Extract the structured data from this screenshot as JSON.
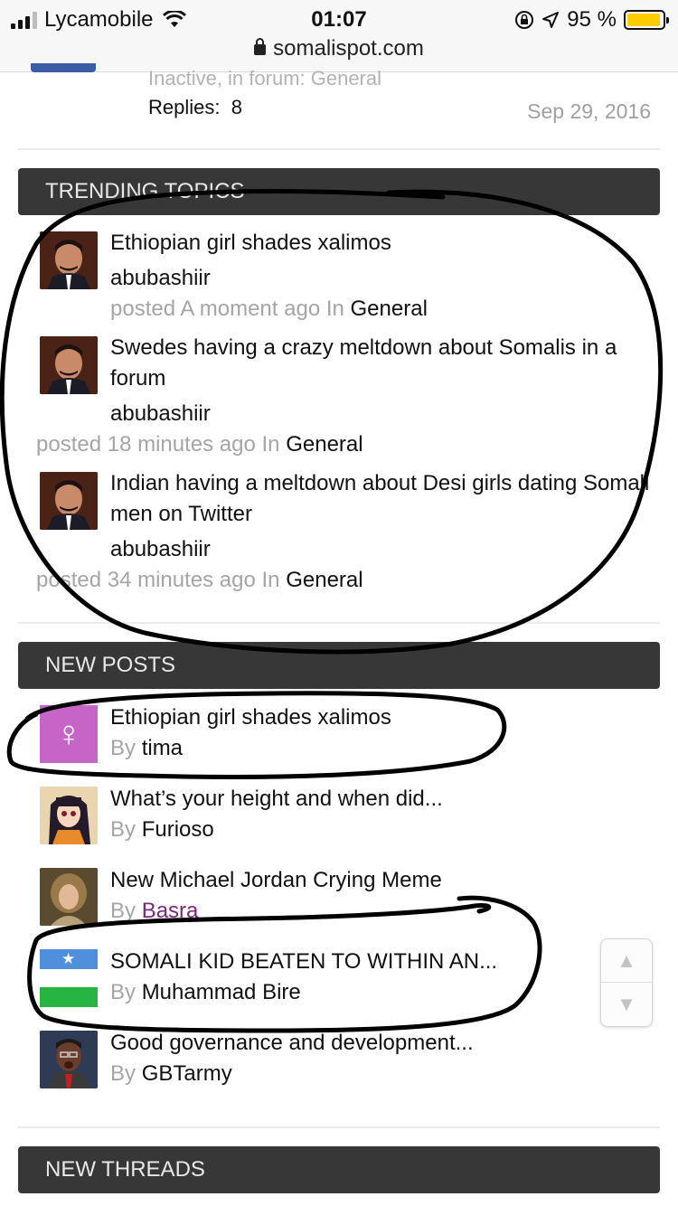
{
  "status": {
    "carrier": "Lycamobile",
    "time": "01:07",
    "battery": "95 %",
    "battery_level": 0.95,
    "url": "somalispot.com"
  },
  "previous_item": {
    "meta": "Inactive, in forum: General",
    "replies_label": "Replies:",
    "replies_count": "8",
    "date": "Sep 29, 2016"
  },
  "trending": {
    "header": "TRENDING TOPICS",
    "items": [
      {
        "title": "Ethiopian girl shades xalimos",
        "author": "abubashiir",
        "posted": "posted A moment ago In",
        "forum": "General"
      },
      {
        "title": "Swedes having a crazy meltdown about Somalis in a forum",
        "author": "abubashiir",
        "posted": "posted 18 minutes ago In",
        "forum": "General"
      },
      {
        "title": "Indian having a meltdown about Desi girls dating Somali men on Twitter",
        "author": "abubashiir",
        "posted": "posted 34 minutes ago In",
        "forum": "General"
      }
    ]
  },
  "new_posts": {
    "header": "NEW POSTS",
    "by_label": "By",
    "items": [
      {
        "title": "Ethiopian girl shades xalimos",
        "user": "tima",
        "avatar": "venus-icon"
      },
      {
        "title": "What’s your height and when did...",
        "user": "Furioso",
        "avatar": "anime-avatar"
      },
      {
        "title": "New Michael Jordan Crying Meme",
        "user": "Basra",
        "avatar": "portrait-avatar"
      },
      {
        "title": "SOMALI KID BEATEN TO WITHIN AN...",
        "user": "Muhammad Bire",
        "avatar": "flag-avatar"
      },
      {
        "title": "Good governance and development...",
        "user": "GBTarmy",
        "avatar": "man-avatar"
      }
    ]
  },
  "new_threads": {
    "header": "NEW THREADS"
  },
  "colors": {
    "header_bg": "#373737",
    "muted_text": "#a5a5a5",
    "username_purple": "#7a2a7a",
    "battery_yellow": "#ffcc00"
  }
}
